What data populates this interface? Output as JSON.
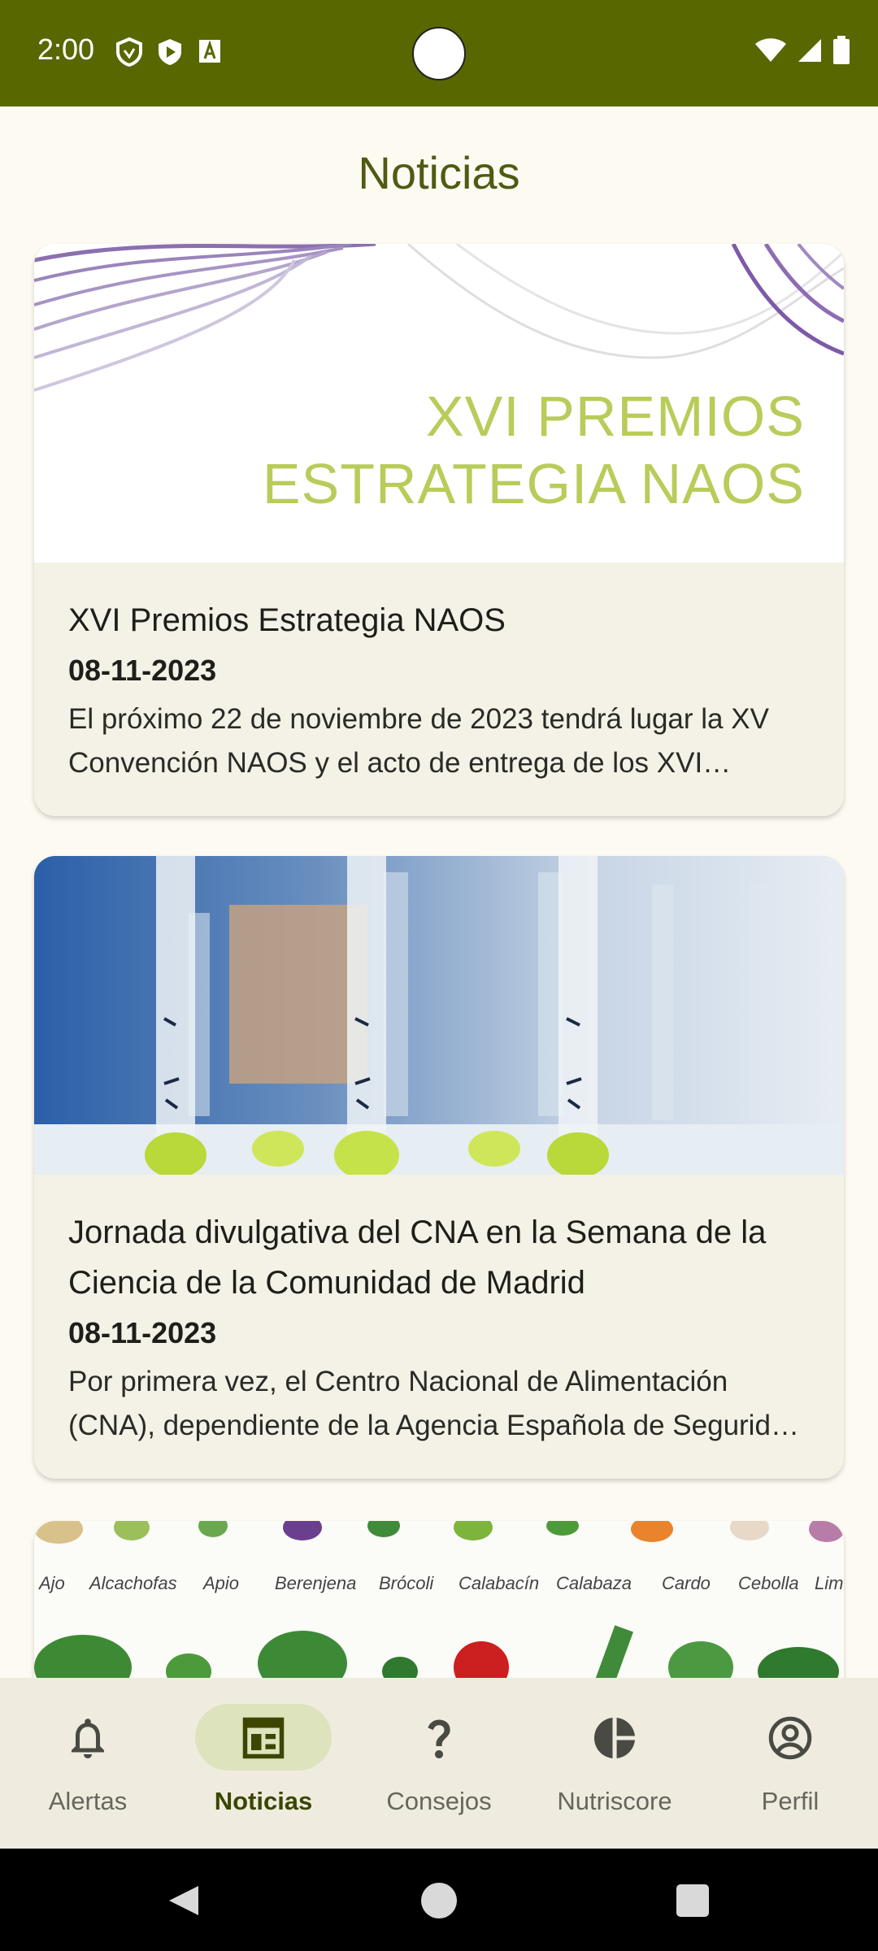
{
  "status_bar": {
    "time": "2:00"
  },
  "page": {
    "title": "Noticias"
  },
  "articles": [
    {
      "image_text_line1": "XVI PREMIOS",
      "image_text_line2": "ESTRATEGIA NAOS",
      "title": "XVI Premios Estrategia NAOS",
      "date": "08-11-2023",
      "summary": "El próximo 22 de noviembre de 2023 tendrá lugar la XV Convención NAOS y el acto de entrega de los XVI Premios Estrategia NAOS"
    },
    {
      "title": "Jornada divulgativa del CNA en la Semana de la Ciencia de la Comunidad de Madrid",
      "date": "08-11-2023",
      "summary": "Por primera vez, el Centro Nacional de Alimentación (CNA), dependiente de la Agencia Española de Seguridad Alimentaria y Nutrición"
    },
    {
      "image_labels": [
        "Ajo",
        "Alcachofas",
        "Apio",
        "Berenjena",
        "Brócoli",
        "Calabacín",
        "Calabaza",
        "Cardo",
        "Cebolla",
        "Lim"
      ]
    }
  ],
  "bottom_nav": [
    {
      "label": "Alertas",
      "icon": "bell-icon",
      "active": false
    },
    {
      "label": "Noticias",
      "icon": "newspaper-icon",
      "active": true
    },
    {
      "label": "Consejos",
      "icon": "question-icon",
      "active": false
    },
    {
      "label": "Nutriscore",
      "icon": "nutriscore-icon",
      "active": false
    },
    {
      "label": "Perfil",
      "icon": "account-circle-icon",
      "active": false
    }
  ],
  "colors": {
    "status_bar": "#586700",
    "title": "#4f5b12",
    "nav_active_pill": "#dde3bd",
    "background": "#fdfaf2",
    "card": "#f4f1e6"
  }
}
